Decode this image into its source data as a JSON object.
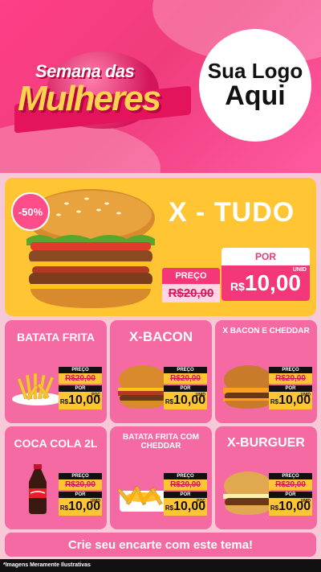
{
  "header": {
    "title_line1": "Semana das",
    "title_line2": "Mulheres",
    "logo_line1": "Sua Logo",
    "logo_line2": "Aqui"
  },
  "featured": {
    "name": "X - TUDO",
    "discount": "-50%",
    "preco_label": "PREÇO",
    "old_price": "R$20,00",
    "por_label": "POR",
    "currency": "R$",
    "new_price": "10,00",
    "unit": "UNID"
  },
  "products": [
    {
      "name": "BATATA FRITA",
      "preco_label": "PREÇO",
      "old_price": "R$20,00",
      "por_label": "POR",
      "currency": "R$",
      "new_price": "10,00",
      "unit": "POÇ"
    },
    {
      "name": "X-BACON",
      "preco_label": "PREÇO",
      "old_price": "R$20,00",
      "por_label": "POR",
      "currency": "R$",
      "new_price": "10,00",
      "unit": "UNID"
    },
    {
      "name": "X BACON E CHEDDAR",
      "preco_label": "PREÇO",
      "old_price": "R$20,00",
      "por_label": "POR",
      "currency": "R$",
      "new_price": "10,00",
      "unit": "UNID"
    },
    {
      "name": "COCA COLA 2L",
      "preco_label": "PREÇO",
      "old_price": "R$20,00",
      "por_label": "POR",
      "currency": "R$",
      "new_price": "10,00",
      "unit": "UNID"
    },
    {
      "name": "BATATA FRITA COM CHEDDAR",
      "preco_label": "PREÇO",
      "old_price": "R$20,00",
      "por_label": "POR",
      "currency": "R$",
      "new_price": "10,00",
      "unit": "POÇ"
    },
    {
      "name": "X-BURGUER",
      "preco_label": "PREÇO",
      "old_price": "R$20,00",
      "por_label": "POR",
      "currency": "R$",
      "new_price": "10,00",
      "unit": "UNID"
    }
  ],
  "cta": "Crie seu encarte com este tema!",
  "disclaimer": "*Imagens Meramente Ilustrativas",
  "colors": {
    "accent": "#f33779",
    "yellow": "#ffc533",
    "card": "#f56aa3"
  }
}
